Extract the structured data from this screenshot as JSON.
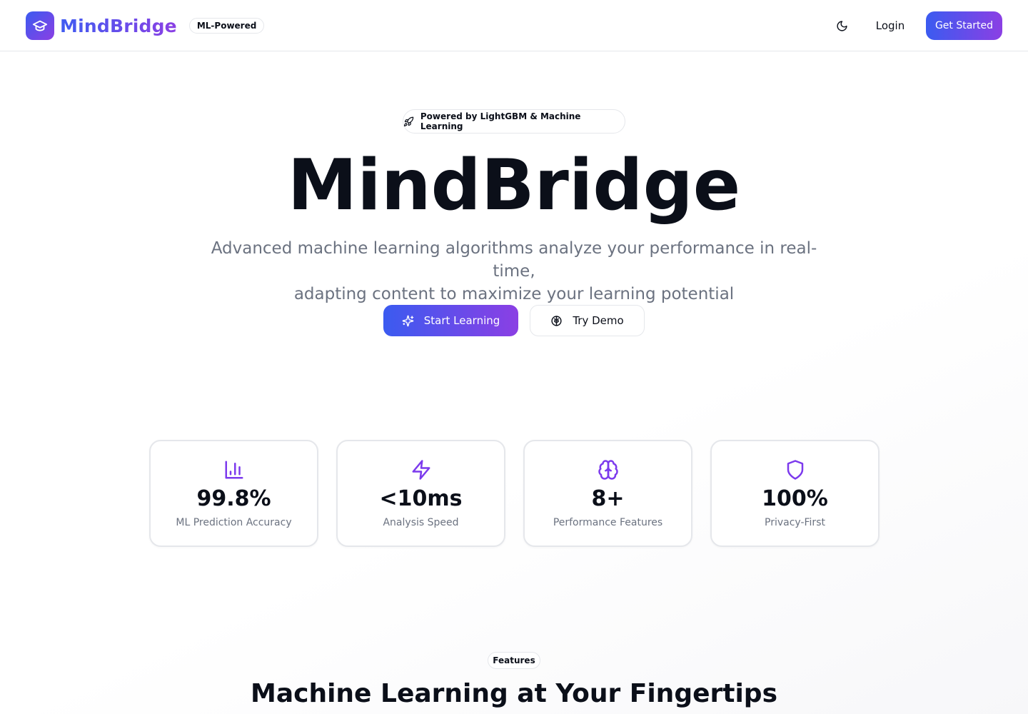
{
  "header": {
    "brand": "MindBridge",
    "badge": "ML-Powered",
    "login": "Login",
    "get_started": "Get Started",
    "icons": {
      "logo": "graduation-cap-icon",
      "theme": "moon-icon"
    }
  },
  "hero": {
    "powered": "Powered by LightGBM & Machine Learning",
    "title": "MindBridge",
    "subtitle_line1": "Advanced machine learning algorithms analyze your performance in real-time,",
    "subtitle_line2": "adapting content to maximize your learning potential",
    "start_learning": "Start Learning",
    "try_demo": "Try Demo",
    "icons": {
      "powered": "rocket-icon",
      "start": "sparkles-icon",
      "demo": "brain-icon"
    }
  },
  "stats": [
    {
      "value": "99.8%",
      "label": "ML Prediction Accuracy",
      "icon": "bar-chart-icon"
    },
    {
      "value": "<10ms",
      "label": "Analysis Speed",
      "icon": "zap-icon"
    },
    {
      "value": "8+",
      "label": "Performance Features",
      "icon": "brain-icon"
    },
    {
      "value": "100%",
      "label": "Privacy-First",
      "icon": "shield-icon"
    }
  ],
  "features": {
    "pill": "Features",
    "title": "Machine Learning at Your Fingertips"
  },
  "colors": {
    "accent_start": "#3b5bf0",
    "accent_end": "#8b3fe4",
    "icon_purple": "#7c3aed",
    "muted_text": "#6b7280",
    "border": "#e5e7eb"
  }
}
